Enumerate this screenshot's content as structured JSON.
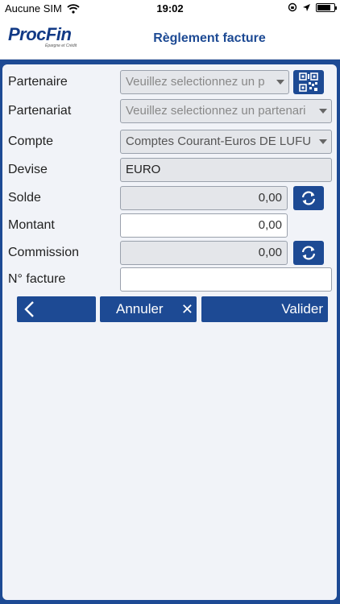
{
  "status": {
    "carrier": "Aucune SIM",
    "time": "19:02"
  },
  "header": {
    "logo": "ProcFin",
    "logo_tagline": "Épargne et Crédit",
    "title": "Règlement facture"
  },
  "form": {
    "partenaire": {
      "label": "Partenaire",
      "placeholder": "Veuillez selectionnez un p"
    },
    "partenariat": {
      "label": "Partenariat",
      "placeholder": "Veuillez selectionnez un partenari"
    },
    "compte": {
      "label": "Compte",
      "value": "Comptes Courant-Euros DE LUFU"
    },
    "devise": {
      "label": "Devise",
      "value": "EURO"
    },
    "solde": {
      "label": "Solde",
      "value": "0,00"
    },
    "montant": {
      "label": "Montant",
      "value": "0,00"
    },
    "commission": {
      "label": "Commission",
      "value": "0,00"
    },
    "facture": {
      "label": "N° facture",
      "value": ""
    }
  },
  "actions": {
    "back": "‹",
    "cancel": "Annuler",
    "cancel_icon": "✕",
    "submit": "Valider"
  },
  "colors": {
    "primary": "#1d4a94",
    "panel": "#f1f3f8"
  }
}
